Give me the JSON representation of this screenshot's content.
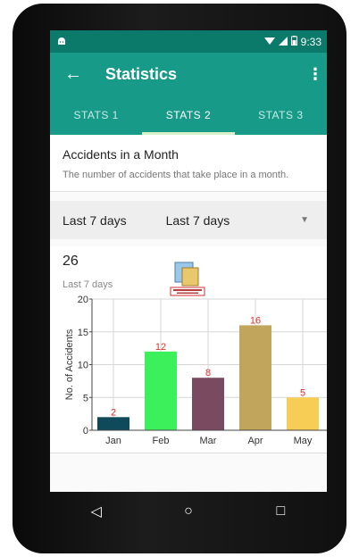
{
  "status": {
    "time": "9:33"
  },
  "appbar": {
    "title": "Statistics"
  },
  "tabs": [
    {
      "label": "STATS 1"
    },
    {
      "label": "STATS 2"
    },
    {
      "label": "STATS 3"
    }
  ],
  "info_card": {
    "title": "Accidents in a Month",
    "description": "The number of accidents that take place in a month."
  },
  "filter": {
    "label": "Last 7 days",
    "selected": "Last 7 days"
  },
  "summary": {
    "total": "26",
    "period": "Last 7 days"
  },
  "chart_data": {
    "type": "bar",
    "ylabel": "No. of Accidents",
    "categories": [
      "Jan",
      "Feb",
      "Mar",
      "Apr",
      "May"
    ],
    "values": [
      2,
      12,
      8,
      16,
      5
    ],
    "colors": [
      "#0e4a5c",
      "#3cf05c",
      "#7a4a60",
      "#c1a55c",
      "#f7cd55"
    ],
    "value_label_color": "#e0302a",
    "ylim": [
      0,
      20
    ],
    "yticks": [
      0,
      5,
      10,
      15,
      20
    ],
    "grid": true
  },
  "nav": {
    "back": "◁",
    "home": "○",
    "recents": "□"
  }
}
